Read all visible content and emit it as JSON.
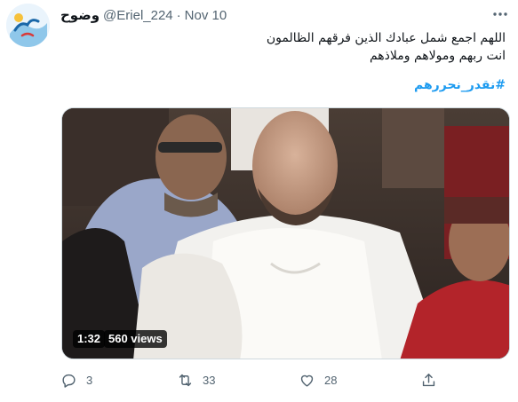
{
  "tweet": {
    "author_name": "وضوح",
    "handle": "@Eriel_224",
    "separator": "·",
    "date": "Nov 10",
    "text_line1": "اللهم اجمع شمل عبادك الذين فرقهم الظالمون",
    "text_line2": "انت ربهم ومولاهم وملاذهم",
    "hashtag": "#نقدر_نحررهم"
  },
  "video": {
    "duration": "1:32",
    "views": "560 views"
  },
  "actions": {
    "replies": "3",
    "retweets": "33",
    "likes": "28"
  },
  "icons": {
    "more": "more-icon",
    "reply": "reply-icon",
    "retweet": "retweet-icon",
    "like": "like-icon",
    "share": "share-icon"
  },
  "colors": {
    "link": "#1d9bf0",
    "secondary_text": "#536471",
    "primary_text": "#0f1419"
  }
}
